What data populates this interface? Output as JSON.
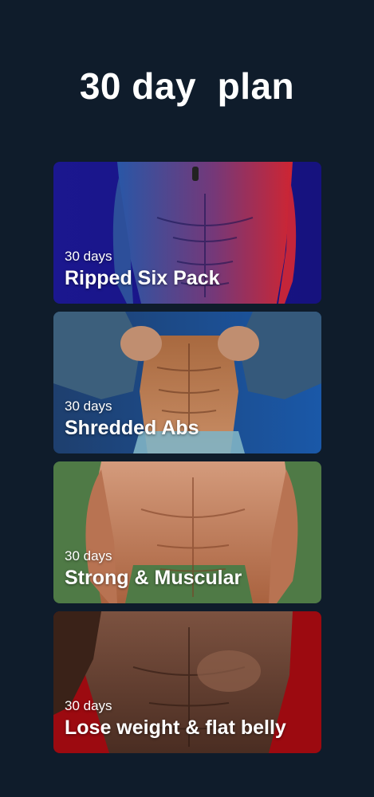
{
  "header": {
    "title": "30 day  plan"
  },
  "plans": [
    {
      "duration": "30 days",
      "name": "Ripped Six Pack",
      "bg_color": "#1a1690",
      "accent_color": "#d8262e"
    },
    {
      "duration": "30 days",
      "name": "Shredded Abs",
      "bg_color": "#1c4a86",
      "accent_color": "#b97a52"
    },
    {
      "duration": "30 days",
      "name": "Strong & Muscular",
      "bg_color": "#4f7a46",
      "accent_color": "#c9805a"
    },
    {
      "duration": "30 days",
      "name": "Lose weight & flat belly",
      "bg_color": "#9c0a10",
      "accent_color": "#6e4532"
    }
  ]
}
